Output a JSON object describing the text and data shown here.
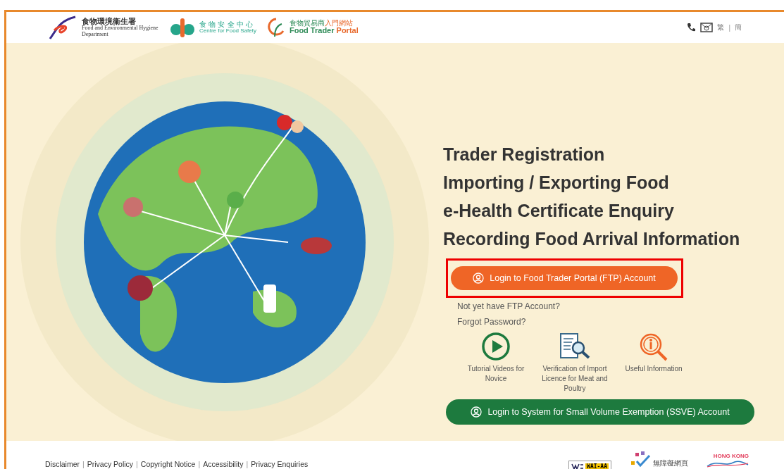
{
  "header": {
    "logos": [
      {
        "kind": "fehd",
        "title": "食物環境衞生署",
        "subtitle": "Food and Environmental Hygiene Department"
      },
      {
        "kind": "cfs",
        "title": "食 物 安 全 中 心",
        "subtitle": "Centre for Food Safety"
      },
      {
        "kind": "ftp",
        "title": "食物貿易商",
        "title_accent": "入門網站",
        "subtitle": "Food Trader",
        "subtitle_accent": "Portal"
      }
    ],
    "language_separator": "|",
    "languages": [
      {
        "label": "繁",
        "selected": false
      },
      {
        "label": "簡",
        "selected": false
      }
    ]
  },
  "hero": {
    "headlines": [
      "Trader Registration",
      "Importing / Exporting Food",
      "e-Health Certificate Enquiry",
      "Recording Food Arrival Information"
    ],
    "primary_button": {
      "label": "Login to Food Trader Portal (FTP) Account",
      "highlighted": true
    },
    "links": [
      "Not yet have FTP Account?",
      "Forgot Password?"
    ],
    "shortcuts": [
      {
        "kind": "video",
        "label": "Tutorial Videos for Novice"
      },
      {
        "kind": "document",
        "label": "Verification of Import Licence for Meat and Poultry"
      },
      {
        "kind": "info",
        "label": "Useful Information"
      }
    ],
    "secondary_button": {
      "label": "Login to System for Small Volume Exemption (SSVE) Account"
    }
  },
  "footer": {
    "link_separator": "|",
    "links": [
      "Disclaimer",
      "Privacy Policy",
      "Copyright Notice",
      "Accessibility",
      "Privacy Enquiries"
    ],
    "badges": [
      {
        "kind": "w3c",
        "text": "WAI-AA"
      },
      {
        "kind": "webforall",
        "text": "無障礙網頁"
      },
      {
        "kind": "hk",
        "text": "HONG KONG"
      }
    ]
  }
}
